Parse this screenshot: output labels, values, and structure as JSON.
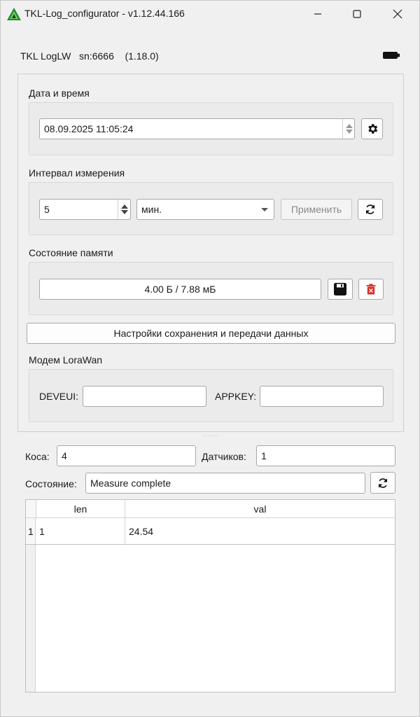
{
  "window": {
    "title": "TKL-Log_configurator - v1.12.44.166"
  },
  "device": {
    "model": "TKL LogLW",
    "serial": "sn:6666",
    "firmware": "(1.18.0)"
  },
  "datetime": {
    "label": "Дата и время",
    "value": "08.09.2025 11:05:24"
  },
  "interval": {
    "label": "Интервал измерения",
    "value": "5",
    "unit": "мин.",
    "apply_label": "Применить"
  },
  "memory": {
    "label": "Состояние памяти",
    "usage": "4.00 Б / 7.88 мБ"
  },
  "storage_settings_label": "Настройки сохранения и передачи данных",
  "modem": {
    "label": "Модем LoraWan",
    "deveui_label": "DEVEUI:",
    "appkey_label": "APPKEY:"
  },
  "kosa": {
    "label": "Коса:",
    "value": "4"
  },
  "sensors": {
    "label": "Датчиков:",
    "value": "1"
  },
  "status": {
    "label": "Состояние:",
    "value": "Measure complete"
  },
  "table": {
    "columns": [
      "len",
      "val"
    ],
    "rows": [
      {
        "index": "1",
        "len": "1",
        "val": "24.54"
      }
    ]
  },
  "colors": {
    "accent_icon_green": "#1e8c3a",
    "delete_red": "#d93025"
  }
}
